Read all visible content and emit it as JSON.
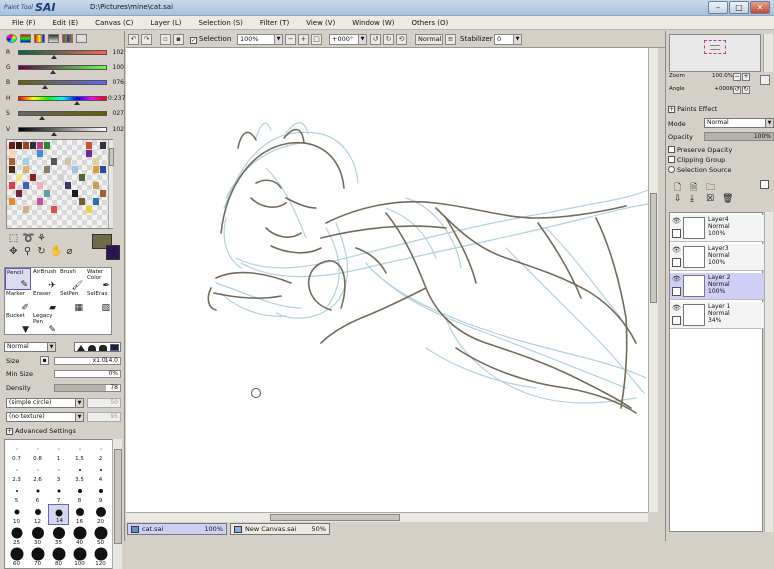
{
  "title_bar": {
    "app_name_small": "Paint Tool",
    "app_name_big": "SAI",
    "document_path": "D:\\Pictures\\mine\\cat.sai",
    "minimize": "–",
    "maximize": "□",
    "close": "✕"
  },
  "menu": [
    "File (F)",
    "Edit (E)",
    "Canvas (C)",
    "Layer (L)",
    "Selection (S)",
    "Filter (T)",
    "View (V)",
    "Window (W)",
    "Others (O)"
  ],
  "color_panel": {
    "sliders": [
      {
        "label": "R",
        "value": "102",
        "level": 0.4
      },
      {
        "label": "G",
        "value": "100",
        "level": 0.39
      },
      {
        "label": "B",
        "value": "076",
        "level": 0.3
      },
      {
        "label": "H",
        "value": "0:237",
        "level": 0.66
      },
      {
        "label": "S",
        "value": "027",
        "level": 0.27
      },
      {
        "label": "V",
        "value": "102",
        "level": 0.4
      }
    ]
  },
  "tools": [
    {
      "label": "Pencil",
      "icon": "pencil-icon",
      "glyph": "✎",
      "selected": true
    },
    {
      "label": "AirBrush",
      "icon": "airbrush-icon",
      "glyph": "✈",
      "selected": false
    },
    {
      "label": "Brush",
      "icon": "brush-icon",
      "glyph": "🖌",
      "selected": false
    },
    {
      "label": "Water Color",
      "icon": "watercolor-icon",
      "glyph": "✒",
      "selected": false
    },
    {
      "label": "Marker",
      "icon": "marker-icon",
      "glyph": "✐",
      "selected": false
    },
    {
      "label": "Eraser",
      "icon": "eraser-icon",
      "glyph": "▰",
      "selected": false
    },
    {
      "label": "SelPen",
      "icon": "selpen-icon",
      "glyph": "▦",
      "selected": false
    },
    {
      "label": "SelEras",
      "icon": "seleras-icon",
      "glyph": "▧",
      "selected": false
    },
    {
      "label": "Bucket",
      "icon": "bucket-icon",
      "glyph": "▼",
      "selected": false
    },
    {
      "label": "Legacy Pen",
      "icon": "legacy-pen-icon",
      "glyph": "✎",
      "selected": false
    }
  ],
  "brush_props": {
    "blend_mode": "Normal",
    "size_label": "Size",
    "size_mult": "x1.0",
    "size_value": "14.0",
    "min_size_label": "Min Size",
    "min_size_value": "0%",
    "density_label": "Density",
    "density_value": "78",
    "density_level": 0.78,
    "shape": "(simple circle)",
    "shape_value": "50",
    "texture": "(no texture)",
    "texture_value": "95",
    "advanced": "Advanced Settings"
  },
  "brush_sizes": [
    {
      "size": "0.7",
      "d": 1
    },
    {
      "size": "0.8",
      "d": 1
    },
    {
      "size": "1",
      "d": 1
    },
    {
      "size": "1.5",
      "d": 1
    },
    {
      "size": "2",
      "d": 1
    },
    {
      "size": "2.3",
      "d": 1
    },
    {
      "size": "2.6",
      "d": 1
    },
    {
      "size": "3",
      "d": 1
    },
    {
      "size": "3.5",
      "d": 2
    },
    {
      "size": "4",
      "d": 2
    },
    {
      "size": "5",
      "d": 2
    },
    {
      "size": "6",
      "d": 3
    },
    {
      "size": "7",
      "d": 3
    },
    {
      "size": "8",
      "d": 4
    },
    {
      "size": "9",
      "d": 4
    },
    {
      "size": "10",
      "d": 5
    },
    {
      "size": "12",
      "d": 6
    },
    {
      "size": "14",
      "d": 7,
      "selected": true
    },
    {
      "size": "16",
      "d": 8
    },
    {
      "size": "20",
      "d": 10
    },
    {
      "size": "25",
      "d": 11
    },
    {
      "size": "30",
      "d": 12
    },
    {
      "size": "35",
      "d": 12
    },
    {
      "size": "40",
      "d": 13
    },
    {
      "size": "50",
      "d": 13
    },
    {
      "size": "60",
      "d": 13
    },
    {
      "size": "70",
      "d": 13
    },
    {
      "size": "80",
      "d": 13
    },
    {
      "size": "100",
      "d": 13
    },
    {
      "size": "120",
      "d": 13
    }
  ],
  "toolbar": {
    "selection_label": "Selection",
    "zoom": "100%",
    "rotation": "+000°",
    "blend": "Normal",
    "stabilizer_label": "Stabilizer",
    "stabilizer_value": "0"
  },
  "doc_tabs": [
    {
      "name": "cat.sai",
      "pct": "100%",
      "active": true
    },
    {
      "name": "New Canvas.sai",
      "pct": "50%",
      "active": false
    }
  ],
  "navigator": {
    "zoom_label": "Zoom",
    "zoom_value": "100.0%",
    "angle_label": "Angle",
    "angle_value": "+0006"
  },
  "layer_props": {
    "paint_effect": "Paints Effect",
    "mode_label": "Mode",
    "mode_value": "Normal",
    "opacity_label": "Opacity",
    "opacity_value": "100%",
    "preserve_opacity": "Preserve Opacity",
    "clipping_group": "Clipping Group",
    "selection_source": "Selection Source"
  },
  "layers": [
    {
      "name": "Layer4",
      "mode": "Normal",
      "opacity": "100%",
      "selected": false
    },
    {
      "name": "Layer3",
      "mode": "Normal",
      "opacity": "100%",
      "selected": false
    },
    {
      "name": "Layer 2",
      "mode": "Normal",
      "opacity": "100%",
      "selected": true
    },
    {
      "name": "Layer 1",
      "mode": "Normal",
      "opacity": "34%",
      "selected": false
    }
  ],
  "colors": {
    "title_bar": "#b5c9e2",
    "selection": "#cfcff5",
    "sketch_blue": "#a9cdd8",
    "sketch_dark": "#6a6552"
  }
}
